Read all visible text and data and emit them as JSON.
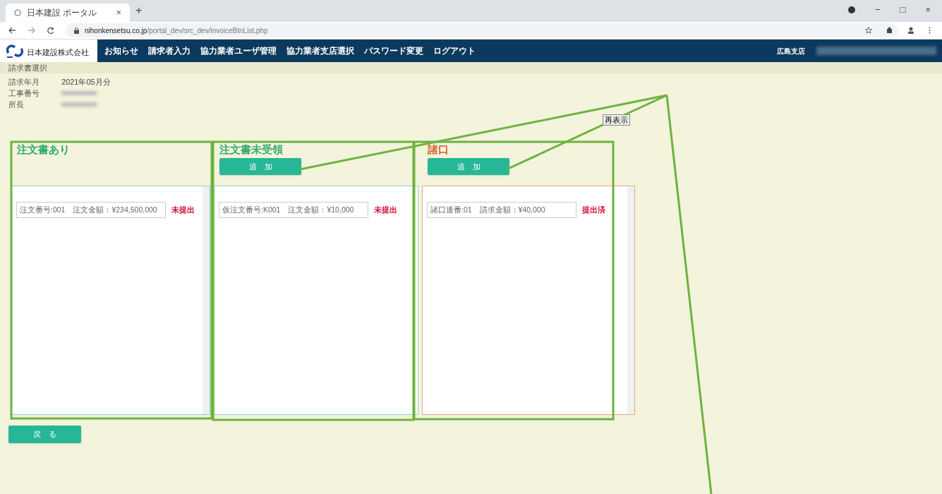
{
  "browser": {
    "tab_title": "日本建設 ポータル",
    "tab_close": "×",
    "new_tab": "+",
    "url_host": "nihonkensetsu.co.jp",
    "url_path": "/portal_dev/src_dev/invoiceBtnList.php",
    "window_controls": [
      "−",
      "□",
      "×"
    ]
  },
  "nav": {
    "logo_text": "日本建設株式会社",
    "items": [
      "お知らせ",
      "請求者入力",
      "協力業者ユーザ管理",
      "協力業者支店選択",
      "パスワード変更",
      "ログアウト"
    ],
    "branch": "広島支店"
  },
  "page_title": "請求書選択",
  "info": [
    {
      "label": "請求年月",
      "value": "2021年05月分"
    },
    {
      "label": "工事番号",
      "redacted": true
    },
    {
      "label": "所長",
      "redacted": true
    }
  ],
  "refresh_button": "再表示",
  "columns": [
    {
      "title": "注文書あり",
      "color": "#2eaa6a",
      "entries": [
        {
          "field": "注文番号:001　注文金額：¥234,500,000",
          "status": "未提出"
        }
      ]
    },
    {
      "title": "注文書未受領",
      "color": "#2eaa6a",
      "add_button": "追　加",
      "entries": [
        {
          "field": "仮注文番号:K001　注文金額：¥10,000",
          "status": "未提出"
        }
      ]
    },
    {
      "title": "諸口",
      "color": "#d0642a",
      "add_button": "追　加",
      "entries": [
        {
          "field": "諸口連番:01　請求金額：¥40,000",
          "status": "提出済"
        }
      ]
    }
  ],
  "back_button": "戻　る"
}
